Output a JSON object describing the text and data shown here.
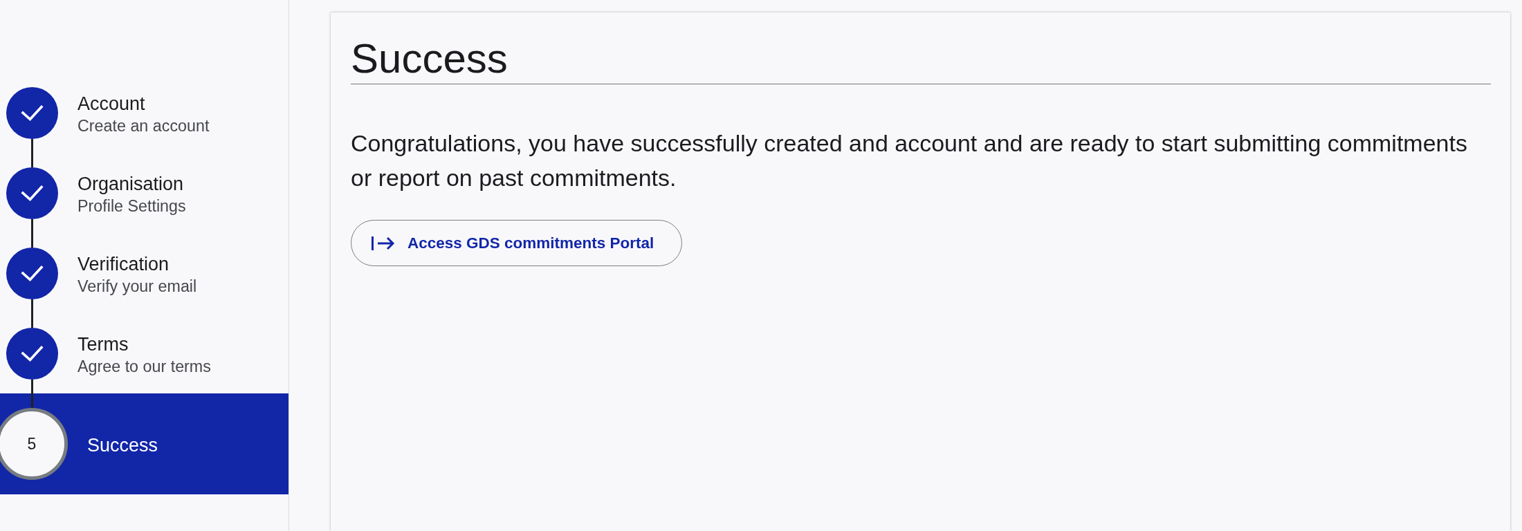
{
  "sidebar": {
    "steps": [
      {
        "title": "Account",
        "subtitle": "Create an account",
        "completed": true,
        "selected": false
      },
      {
        "title": "Organisation",
        "subtitle": "Profile Settings",
        "completed": true,
        "selected": false
      },
      {
        "title": "Verification",
        "subtitle": "Verify your email",
        "completed": true,
        "selected": false
      },
      {
        "title": "Terms",
        "subtitle": "Agree to our terms",
        "completed": true,
        "selected": false
      },
      {
        "number": "5",
        "title": "Success",
        "completed": false,
        "selected": true
      }
    ]
  },
  "main": {
    "title": "Success",
    "message": "Congratulations, you have successfully created and account and are ready to start submitting commitments or report on past commitments.",
    "button": {
      "label": "Access GDS commitments Portal"
    }
  }
}
